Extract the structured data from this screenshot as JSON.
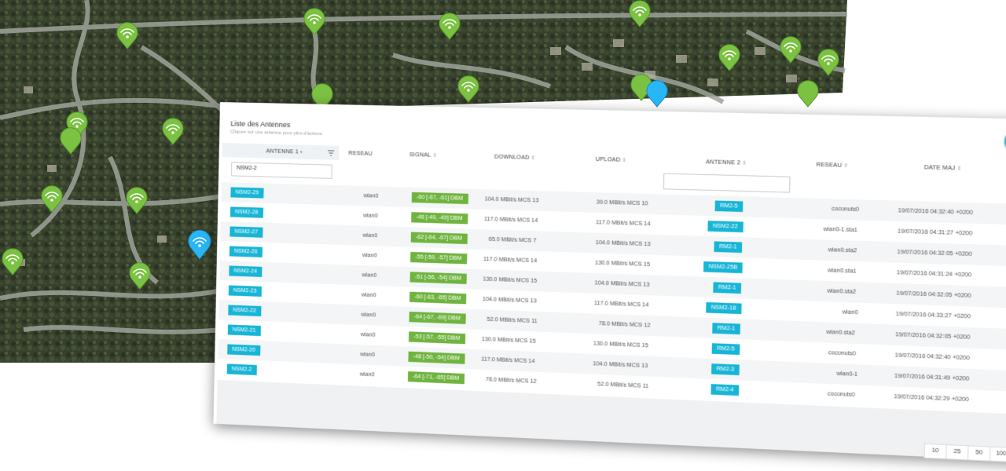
{
  "panel": {
    "title": "Liste des Antennes",
    "subtitle": "Cliquez sur une antenne pour plus d'actions"
  },
  "columns": {
    "antenne1": "ANTENNE 1",
    "reseau1": "RESEAU",
    "signal": "SIGNAL",
    "download": "DOWNLOAD",
    "upload": "UPLOAD",
    "antenne2": "ANTENNE 2",
    "reseau2": "RESEAU",
    "date": "DATE MAJ"
  },
  "filter": {
    "antenne1_value": "NSM2-2",
    "antenne2_value": ""
  },
  "rows": [
    {
      "antenne1": "NSM2-29",
      "reseau1": "wlan0",
      "signal": "-60 [-67, -61] DBM",
      "download": "104.0 MBit/s MCS 13",
      "upload": "39.0 MBit/s MCS 10",
      "antenne2": "RM2-5",
      "reseau2": "coconuts0",
      "date": "19/07/2016 04:32:40 +0200"
    },
    {
      "antenne1": "NSM2-28",
      "reseau1": "wlan0",
      "signal": "-46 [-49, -49] DBM",
      "download": "117.0 MBit/s MCS 14",
      "upload": "117.0 MBit/s MCS 14",
      "antenne2": "NSM2-22",
      "reseau2": "wlan0-1.sta1",
      "date": "19/07/2016 04:31:27 +0200"
    },
    {
      "antenne1": "NSM2-27",
      "reseau1": "wlan0",
      "signal": "-62 [-64, -67] DBM",
      "download": "65.0 MBit/s MCS 7",
      "upload": "104.0 MBit/s MCS 13",
      "antenne2": "RM2-1",
      "reseau2": "wlan0.sta2",
      "date": "19/07/2016 04:32:05 +0200"
    },
    {
      "antenne1": "NSM2-26",
      "reseau1": "wlan0",
      "signal": "-55 [-59, -57] DBM",
      "download": "117.0 MBit/s MCS 14",
      "upload": "130.0 MBit/s MCS 15",
      "antenne2": "NSM2-25B",
      "reseau2": "wlan0.sta1",
      "date": "19/07/2016 04:31:24 +0200"
    },
    {
      "antenne1": "NSM2-24",
      "reseau1": "wlan0",
      "signal": "-51 [-56, -54] DBM",
      "download": "130.0 MBit/s MCS 15",
      "upload": "104.0 MBit/s MCS 13",
      "antenne2": "RM2-1",
      "reseau2": "wlan0.sta2",
      "date": "19/07/2016 04:32:05 +0200"
    },
    {
      "antenne1": "NSM2-23",
      "reseau1": "wlan0",
      "signal": "-60 [-63, -65] DBM",
      "download": "104.0 MBit/s MCS 13",
      "upload": "117.0 MBit/s MCS 14",
      "antenne2": "NSM2-18",
      "reseau2": "wlan0",
      "date": "19/07/2016 04:33:27 +0200"
    },
    {
      "antenne1": "NSM2-22",
      "reseau1": "wlan0",
      "signal": "-64 [-67, -69] DBM",
      "download": "52.0 MBit/s MCS 11",
      "upload": "78.0 MBit/s MCS 12",
      "antenne2": "RM2-1",
      "reseau2": "wlan0.sta2",
      "date": "19/07/2016 04:32:05 +0200"
    },
    {
      "antenne1": "NSM2-21",
      "reseau1": "wlan0",
      "signal": "-53 [-57, -55] DBM",
      "download": "130.0 MBit/s MCS 15",
      "upload": "130.0 MBit/s MCS 15",
      "antenne2": "RM2-5",
      "reseau2": "coconuts0",
      "date": "19/07/2016 04:32:40 +0200"
    },
    {
      "antenne1": "NSM2-20",
      "reseau1": "wlan0",
      "signal": "-48 [-50, -54] DBM",
      "download": "117.0 MBit/s MCS 14",
      "upload": "104.0 MBit/s MCS 13",
      "antenne2": "RM2-3",
      "reseau2": "wlan0-1",
      "date": "19/07/2016 04:31:49 +0200"
    },
    {
      "antenne1": "NSM2-2",
      "reseau1": "wlan0",
      "signal": "-64 [-71, -65] DBM",
      "download": "78.0 MBit/s MCS 12",
      "upload": "52.0 MBit/s MCS 11",
      "antenne2": "RM2-4",
      "reseau2": "coconuts0",
      "date": "19/07/2016 04:32:29 +0200"
    }
  ],
  "pagination": [
    "10",
    "25",
    "50",
    "100"
  ],
  "colors": {
    "accent_blue": "#17b5d6",
    "signal_green": "#6fb43f",
    "marker_green": "#7cc242",
    "marker_blue": "#29b6f6"
  },
  "icons": {
    "fab": "add-user-icon",
    "markers": "wifi-marker-icon",
    "filter": "filter-icon"
  }
}
